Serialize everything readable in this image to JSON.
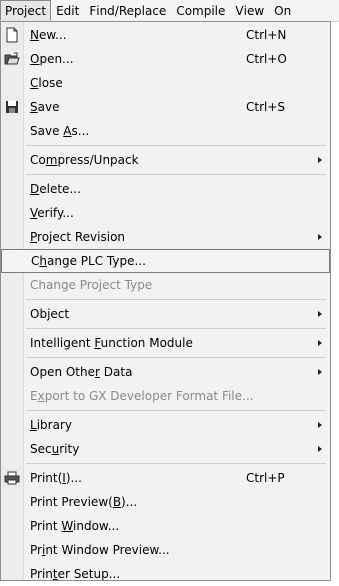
{
  "menubar": {
    "items": [
      {
        "pre": "Pro",
        "u": "j",
        "post": "ect"
      },
      {
        "pre": "",
        "u": "E",
        "post": "dit"
      },
      {
        "pre": "",
        "u": "F",
        "post": "ind/Replace"
      },
      {
        "pre": "",
        "u": "C",
        "post": "ompile"
      },
      {
        "pre": "",
        "u": "V",
        "post": "iew"
      },
      {
        "pre": "",
        "u": "O",
        "post": "n"
      }
    ]
  },
  "menu": {
    "new": {
      "pre": "",
      "u": "N",
      "post": "ew...",
      "shortcut": "Ctrl+N"
    },
    "open": {
      "pre": "",
      "u": "O",
      "post": "pen...",
      "shortcut": "Ctrl+O"
    },
    "close": {
      "pre": "",
      "u": "C",
      "post": "lose"
    },
    "save": {
      "pre": "",
      "u": "S",
      "post": "ave",
      "shortcut": "Ctrl+S"
    },
    "save_as": {
      "pre": "Save ",
      "u": "A",
      "post": "s..."
    },
    "compress": {
      "pre": "Co",
      "u": "m",
      "post": "press/Unpack"
    },
    "delete": {
      "pre": "",
      "u": "D",
      "post": "elete..."
    },
    "verify": {
      "pre": "",
      "u": "V",
      "post": "erify..."
    },
    "revision": {
      "pre": "",
      "u": "P",
      "post": "roject Revision"
    },
    "change_plc": {
      "pre": "C",
      "u": "h",
      "post": "ange PLC Type..."
    },
    "change_project": {
      "pre": "Change Project Type",
      "u": "",
      "post": ""
    },
    "object": {
      "pre": "Ob",
      "u": "j",
      "post": "ect"
    },
    "ifm": {
      "pre": "Intelligent ",
      "u": "F",
      "post": "unction Module"
    },
    "other": {
      "pre": "Open Othe",
      "u": "r",
      "post": " Data"
    },
    "export": {
      "pre": "E",
      "u": "x",
      "post": "port to GX Developer Format File..."
    },
    "library": {
      "pre": "",
      "u": "L",
      "post": "ibrary"
    },
    "security": {
      "pre": "Sec",
      "u": "u",
      "post": "rity"
    },
    "print": {
      "pre": "Print(",
      "u": "I",
      "post": ")...",
      "shortcut": "Ctrl+P"
    },
    "preview": {
      "pre": "Print Preview(",
      "u": "B",
      "post": ")..."
    },
    "window": {
      "pre": "Print ",
      "u": "W",
      "post": "indow..."
    },
    "window_preview": {
      "pre": "Pr",
      "u": "i",
      "post": "nt Window Preview..."
    },
    "setup": {
      "pre": "Prin",
      "u": "t",
      "post": "er Setup..."
    }
  },
  "colors": {
    "highlight_border": "#7a7a7a",
    "disabled_text": "#8a8a8a",
    "menu_bg": "#f2f2f2"
  }
}
